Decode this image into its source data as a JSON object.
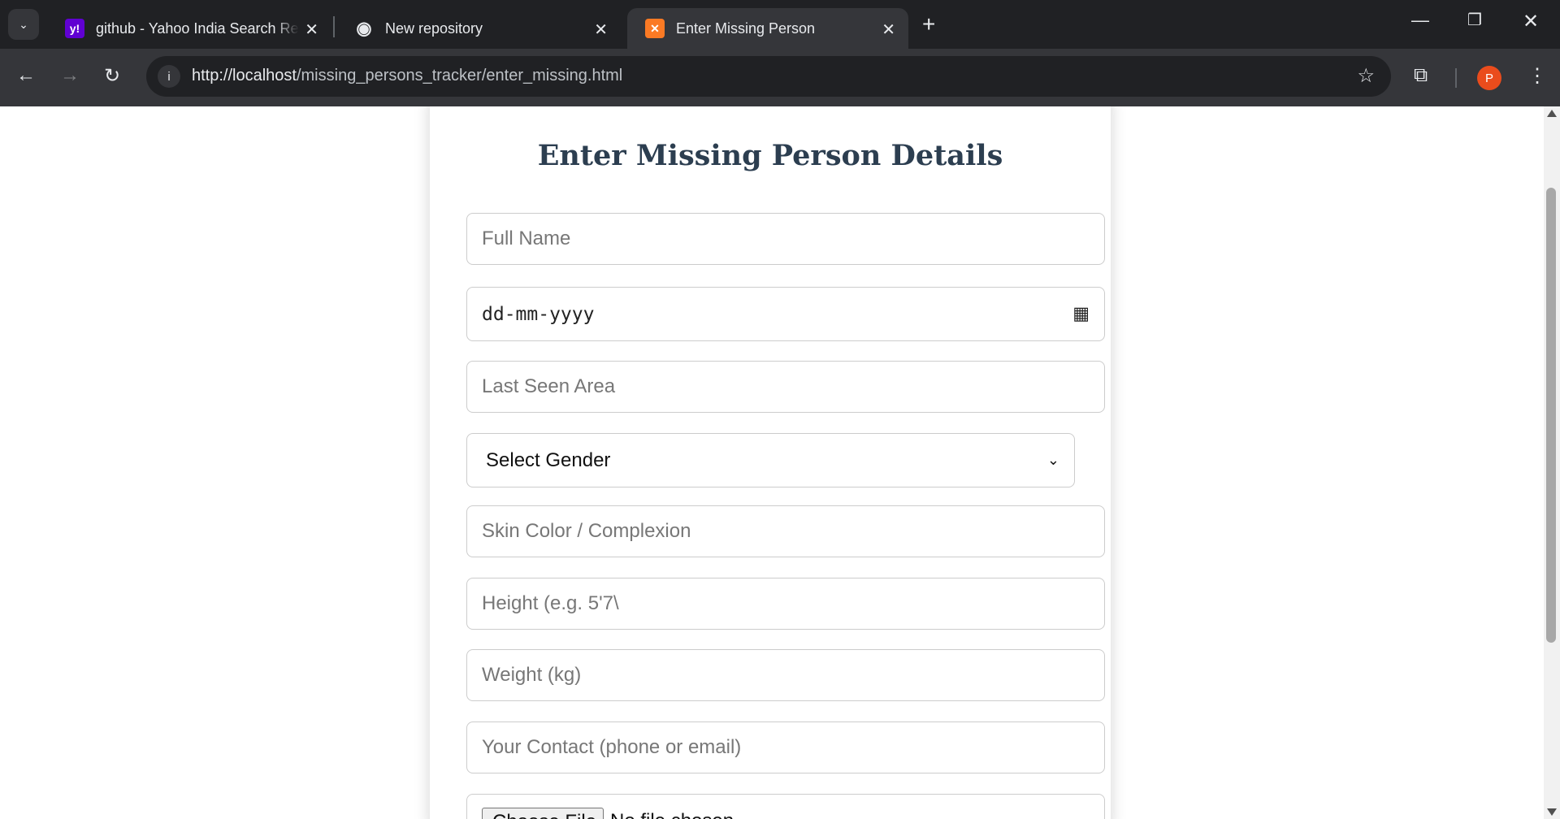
{
  "browser": {
    "tabs": [
      {
        "title": "github - Yahoo India Search Re",
        "favicon": "yahoo-icon",
        "favicon_glyph": "y!",
        "favicon_color": "#6001d2",
        "active": false
      },
      {
        "title": "New repository",
        "favicon": "github-icon",
        "favicon_glyph": "◉",
        "favicon_color": "#e8eaed",
        "active": false
      },
      {
        "title": "Enter Missing Person",
        "favicon": "xampp-icon",
        "favicon_glyph": "✕",
        "favicon_color": "#fb7a24",
        "active": true
      }
    ],
    "url_host": "http://localhost",
    "url_path": "/missing_persons_tracker/enter_missing.html",
    "profile_initial": "P"
  },
  "form": {
    "heading": "Enter Missing Person Details",
    "full_name_placeholder": "Full Name",
    "dob_placeholder": "dd-mm-yyyy",
    "last_seen_placeholder": "Last Seen Area",
    "gender_selected": "Select Gender",
    "skin_placeholder": "Skin Color / Complexion",
    "height_placeholder": "Height (e.g. 5'7\\",
    "weight_placeholder": "Weight (kg)",
    "contact_placeholder": "Your Contact (phone or email)",
    "file_button": "Choose File",
    "file_status": "No file chosen"
  }
}
